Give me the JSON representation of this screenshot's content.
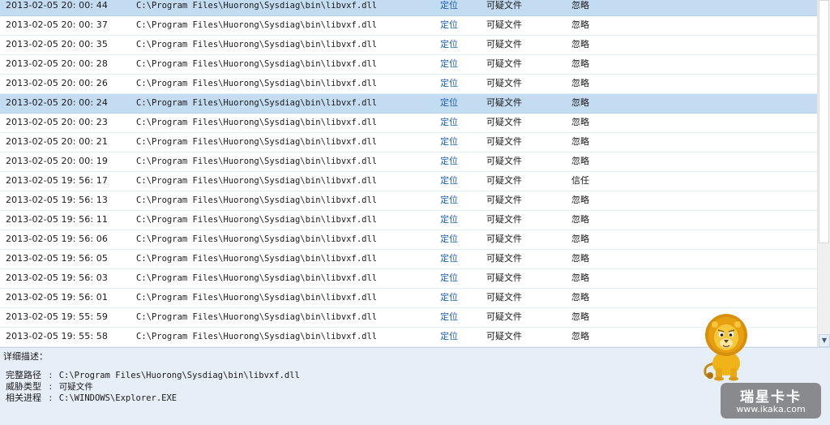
{
  "colors": {
    "selected_row": "#c4dcf2",
    "link": "#1a5fb4",
    "details_bg": "#e6eef8"
  },
  "rows": [
    {
      "time": "2013-02-05 20: 00: 44",
      "path": "C:\\Program Files\\Huorong\\Sysdiag\\bin\\libvxf.dll",
      "locate": "定位",
      "type": "可疑文件",
      "action": "忽略",
      "selected": true
    },
    {
      "time": "2013-02-05 20: 00: 37",
      "path": "C:\\Program Files\\Huorong\\Sysdiag\\bin\\libvxf.dll",
      "locate": "定位",
      "type": "可疑文件",
      "action": "忽略",
      "selected": false
    },
    {
      "time": "2013-02-05 20: 00: 35",
      "path": "C:\\Program Files\\Huorong\\Sysdiag\\bin\\libvxf.dll",
      "locate": "定位",
      "type": "可疑文件",
      "action": "忽略",
      "selected": false
    },
    {
      "time": "2013-02-05 20: 00: 28",
      "path": "C:\\Program Files\\Huorong\\Sysdiag\\bin\\libvxf.dll",
      "locate": "定位",
      "type": "可疑文件",
      "action": "忽略",
      "selected": false
    },
    {
      "time": "2013-02-05 20: 00: 26",
      "path": "C:\\Program Files\\Huorong\\Sysdiag\\bin\\libvxf.dll",
      "locate": "定位",
      "type": "可疑文件",
      "action": "忽略",
      "selected": false
    },
    {
      "time": "2013-02-05 20: 00: 24",
      "path": "C:\\Program Files\\Huorong\\Sysdiag\\bin\\libvxf.dll",
      "locate": "定位",
      "type": "可疑文件",
      "action": "忽略",
      "selected": true
    },
    {
      "time": "2013-02-05 20: 00: 23",
      "path": "C:\\Program Files\\Huorong\\Sysdiag\\bin\\libvxf.dll",
      "locate": "定位",
      "type": "可疑文件",
      "action": "忽略",
      "selected": false
    },
    {
      "time": "2013-02-05 20: 00: 21",
      "path": "C:\\Program Files\\Huorong\\Sysdiag\\bin\\libvxf.dll",
      "locate": "定位",
      "type": "可疑文件",
      "action": "忽略",
      "selected": false
    },
    {
      "time": "2013-02-05 20: 00: 19",
      "path": "C:\\Program Files\\Huorong\\Sysdiag\\bin\\libvxf.dll",
      "locate": "定位",
      "type": "可疑文件",
      "action": "忽略",
      "selected": false
    },
    {
      "time": "2013-02-05 19: 56: 17",
      "path": "C:\\Program Files\\Huorong\\Sysdiag\\bin\\libvxf.dll",
      "locate": "定位",
      "type": "可疑文件",
      "action": "信任",
      "selected": false
    },
    {
      "time": "2013-02-05 19: 56: 13",
      "path": "C:\\Program Files\\Huorong\\Sysdiag\\bin\\libvxf.dll",
      "locate": "定位",
      "type": "可疑文件",
      "action": "忽略",
      "selected": false
    },
    {
      "time": "2013-02-05 19: 56: 11",
      "path": "C:\\Program Files\\Huorong\\Sysdiag\\bin\\libvxf.dll",
      "locate": "定位",
      "type": "可疑文件",
      "action": "忽略",
      "selected": false
    },
    {
      "time": "2013-02-05 19: 56: 06",
      "path": "C:\\Program Files\\Huorong\\Sysdiag\\bin\\libvxf.dll",
      "locate": "定位",
      "type": "可疑文件",
      "action": "忽略",
      "selected": false
    },
    {
      "time": "2013-02-05 19: 56: 05",
      "path": "C:\\Program Files\\Huorong\\Sysdiag\\bin\\libvxf.dll",
      "locate": "定位",
      "type": "可疑文件",
      "action": "忽略",
      "selected": false
    },
    {
      "time": "2013-02-05 19: 56: 03",
      "path": "C:\\Program Files\\Huorong\\Sysdiag\\bin\\libvxf.dll",
      "locate": "定位",
      "type": "可疑文件",
      "action": "忽略",
      "selected": false
    },
    {
      "time": "2013-02-05 19: 56: 01",
      "path": "C:\\Program Files\\Huorong\\Sysdiag\\bin\\libvxf.dll",
      "locate": "定位",
      "type": "可疑文件",
      "action": "忽略",
      "selected": false
    },
    {
      "time": "2013-02-05 19: 55: 59",
      "path": "C:\\Program Files\\Huorong\\Sysdiag\\bin\\libvxf.dll",
      "locate": "定位",
      "type": "可疑文件",
      "action": "忽略",
      "selected": false
    },
    {
      "time": "2013-02-05 19: 55: 58",
      "path": "C:\\Program Files\\Huorong\\Sysdiag\\bin\\libvxf.dll",
      "locate": "定位",
      "type": "可疑文件",
      "action": "忽略",
      "selected": false
    }
  ],
  "scrollbar": {
    "down_icon": "arrow-down-icon",
    "down_glyph": "▼"
  },
  "details": {
    "title": "详细描述：",
    "separator": ":",
    "lines": [
      {
        "label": "完整路径",
        "value": "C:\\Program Files\\Huorong\\Sysdiag\\bin\\libvxf.dll"
      },
      {
        "label": "威胁类型",
        "value": "可疑文件"
      },
      {
        "label": "相关进程",
        "value": "C:\\WINDOWS\\Explorer.EXE"
      }
    ]
  },
  "mascot": {
    "icon": "lion-mascot-icon"
  },
  "watermark": {
    "main": "瑞星卡卡",
    "sub": "www.ikaka.com"
  }
}
